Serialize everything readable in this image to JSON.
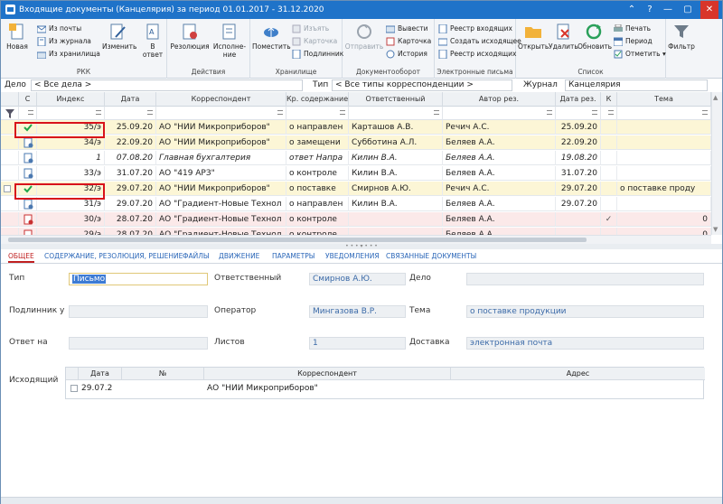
{
  "window": {
    "title": "Входящие документы (Канцелярия) за период 01.01.2017 - 31.12.2020",
    "controls": [
      "⌃",
      "?",
      "—",
      "▢",
      "✕"
    ]
  },
  "ribbon": {
    "rkk": {
      "label": "РКК",
      "new": "Новая",
      "from_mail": "Из почты",
      "from_journal": "Из журнала",
      "from_storage": "Из хранилища",
      "edit": "Изменить",
      "to_reply": "В ответ"
    },
    "actions": {
      "label": "Действия",
      "resolution": "Резолюция",
      "execution": "Исполне-ние"
    },
    "storage": {
      "label": "Хранилище",
      "place": "Поместить",
      "extract": "Изъять",
      "card": "Карточка",
      "original": "Подлинник"
    },
    "docflow": {
      "label": "Документооборот",
      "send": "Отправить",
      "output": "Вывести",
      "card": "Карточка",
      "history": "История"
    },
    "email": {
      "label": "Электронные письма",
      "reg_in": "Реестр входящих",
      "create_out": "Создать исходящее",
      "reg_out": "Реестр исходящих"
    },
    "list": {
      "label": "Список",
      "open": "Открыть",
      "delete": "Удалить",
      "refresh": "Обновить",
      "print": "Печать",
      "period": "Период",
      "mark": "Отметить"
    },
    "filter": {
      "label": "Фильтр"
    }
  },
  "filters": {
    "case_label": "Дело",
    "case_value": "< Все дела >",
    "type_label": "Тип",
    "type_value": "< Все типы корреспонденции >",
    "journal_label": "Журнал",
    "journal_value": "Канцелярия"
  },
  "grid": {
    "columns": [
      "С",
      "Индекс",
      "Дата",
      "Корреспондент",
      "Кр. содержание",
      "Ответственный",
      "Автор рез.",
      "Дата рез.",
      "К",
      "Тема"
    ],
    "rows": [
      {
        "icon": "check",
        "index": "35/э",
        "date": "25.09.20",
        "corr": "АО \"НИИ Микроприборов\"",
        "summary": "о направлен",
        "resp": "Карташов А.В.",
        "author": "Речич А.С.",
        "rdate": "25.09.20",
        "k": "",
        "topic": "",
        "bg": "#fcf6d6",
        "italic": false
      },
      {
        "icon": "doc",
        "index": "34/э",
        "date": "22.09.20",
        "corr": "АО \"НИИ Микроприборов\"",
        "summary": "о замещени",
        "resp": "Субботина А.Л.",
        "author": "Беляев А.А.",
        "rdate": "22.09.20",
        "k": "",
        "topic": "",
        "bg": "#fcf6d6",
        "italic": false
      },
      {
        "icon": "doc",
        "index": "1",
        "date": "07.08.20",
        "corr": "Главная бухгалтерия",
        "summary": "ответ Напра",
        "resp": "Килин В.А.",
        "author": "Беляев А.А.",
        "rdate": "19.08.20",
        "k": "",
        "topic": "",
        "bg": "#ffffff",
        "italic": true
      },
      {
        "icon": "doc",
        "index": "33/э",
        "date": "31.07.20",
        "corr": "АО \"419 АРЗ\"",
        "summary": "о контроле",
        "resp": "Килин В.А.",
        "author": "Беляев А.А.",
        "rdate": "31.07.20",
        "k": "",
        "topic": "",
        "bg": "#ffffff",
        "italic": false
      },
      {
        "icon": "check",
        "index": "32/э",
        "date": "29.07.20",
        "corr": "АО \"НИИ Микроприборов\"",
        "summary": "о поставке",
        "resp": "Смирнов А.Ю.",
        "author": "Речич А.С.",
        "rdate": "29.07.20",
        "k": "",
        "topic": "о поставке проду",
        "bg": "#fcf6d6",
        "italic": false
      },
      {
        "icon": "doc",
        "index": "31/э",
        "date": "29.07.20",
        "corr": "АО \"Градиент-Новые Технол",
        "summary": "о направлен",
        "resp": "Килин В.А.",
        "author": "Беляев А.А.",
        "rdate": "29.07.20",
        "k": "",
        "topic": "",
        "bg": "#ffffff",
        "italic": false
      },
      {
        "icon": "doc-red",
        "index": "30/э",
        "date": "28.07.20",
        "corr": "АО \"Градиент-Новые Технол",
        "summary": "о контроле",
        "resp": "",
        "author": "Беляев А.А.",
        "rdate": "",
        "k": "✓",
        "topic": "",
        "extra": "0",
        "bg": "#fbe9e9",
        "italic": false
      },
      {
        "icon": "doc-red",
        "index": "29/э",
        "date": "28.07.20",
        "corr": "АО \"Градиент-Новые Технол",
        "summary": "о контроле",
        "resp": "",
        "author": "Беляев А.А.",
        "rdate": "",
        "k": "",
        "topic": "",
        "extra": "0",
        "bg": "#fbe9e9",
        "italic": false
      }
    ]
  },
  "tabs": [
    "ОБЩЕЕ",
    "СОДЕРЖАНИЕ, РЕЗОЛЮЦИЯ, РЕШЕНИЕ",
    "ФАЙЛЫ",
    "ДВИЖЕНИЕ",
    "ПАРАМЕТРЫ",
    "УВЕДОМЛЕНИЯ",
    "СВЯЗАННЫЕ ДОКУМЕНТЫ"
  ],
  "form": {
    "type_label": "Тип",
    "type_value": "Письмо",
    "resp_label": "Ответственный",
    "resp_value": "Смирнов А.Ю.",
    "case_label": "Дело",
    "case_value": "",
    "orig_label": "Подлинник у",
    "orig_value": "",
    "operator_label": "Оператор",
    "operator_value": "Мингазова В.Р.",
    "topic_label": "Тема",
    "topic_value": "о поставке продукции",
    "reply_label": "Ответ на",
    "reply_value": "",
    "sheets_label": "Листов",
    "sheets_value": "1",
    "delivery_label": "Доставка",
    "delivery_value": "электронная почта",
    "outgoing_label": "Исходящий"
  },
  "outgoing": {
    "columns": [
      "Дата",
      "№",
      "Корреспондент",
      "Адрес"
    ],
    "row": {
      "date": "29.07.2",
      "num": "",
      "corr": "АО \"НИИ Микроприборов\"",
      "address": ""
    }
  }
}
